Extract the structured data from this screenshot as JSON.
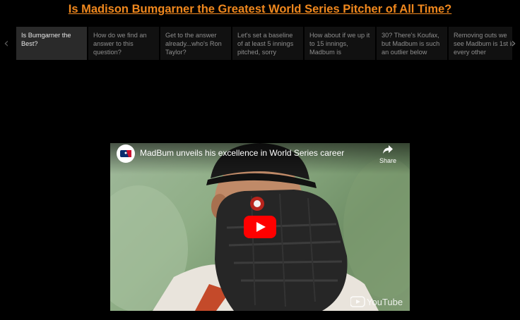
{
  "page": {
    "title": "Is Madison Bumgarner the Greatest World Series Pitcher of All Time?"
  },
  "carousel": {
    "slides": [
      {
        "text": "Is Bumgarner the Best?"
      },
      {
        "text": "How do we find an answer to this question?"
      },
      {
        "text": "Get to the answer already...who's Ron Taylor?"
      },
      {
        "text": "Let's set a baseline of at least 5 innings pitched, sorry"
      },
      {
        "text": "How about if we up it to 15 innings, Madbum is"
      },
      {
        "text": "30? There's Koufax, but Madbum is such an outlier below"
      },
      {
        "text": "Removing outs we see Madbum is 1st in every other"
      }
    ],
    "active_index": 0
  },
  "video": {
    "title": "MadBum unveils his excellence in World Series career",
    "share_label": "Share",
    "watermark": "YouTube",
    "colors": {
      "play_button": "#ff0000",
      "title_link": "#f0881e"
    }
  },
  "icons": {
    "prev": "chevron-left-icon",
    "next": "chevron-right-icon",
    "share": "share-arrow-icon",
    "play": "play-icon",
    "channel": "mlb-logo-icon"
  }
}
